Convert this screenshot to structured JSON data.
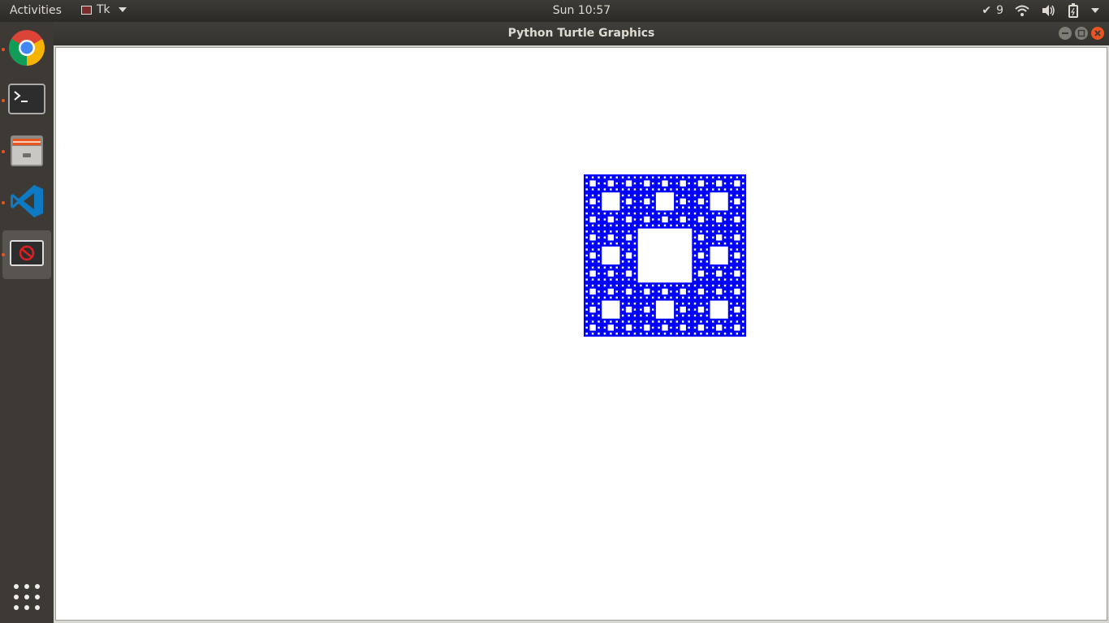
{
  "topbar": {
    "activities_label": "Activities",
    "app_menu_label": "Tk",
    "clock": "Sun 10:57",
    "updates_count": "9"
  },
  "dock": {
    "items": [
      {
        "name": "Chrome",
        "icon": "chrome-icon",
        "running": true
      },
      {
        "name": "Terminal",
        "icon": "terminal-icon",
        "running": true
      },
      {
        "name": "Files",
        "icon": "files-icon",
        "running": true
      },
      {
        "name": "Visual Studio Code",
        "icon": "vscode-icon",
        "running": true
      },
      {
        "name": "Tk",
        "icon": "tk-app-icon",
        "running": true,
        "active": true
      }
    ]
  },
  "window": {
    "title": "Python Turtle Graphics"
  },
  "fractal": {
    "name": "Sierpinski carpet",
    "fill_color": "#0000ff",
    "hole_color": "#ffffff",
    "depth": 4
  },
  "colors": {
    "accent": "#e95420",
    "topbar": "#2b2a27",
    "dock": "#3d3a35"
  }
}
